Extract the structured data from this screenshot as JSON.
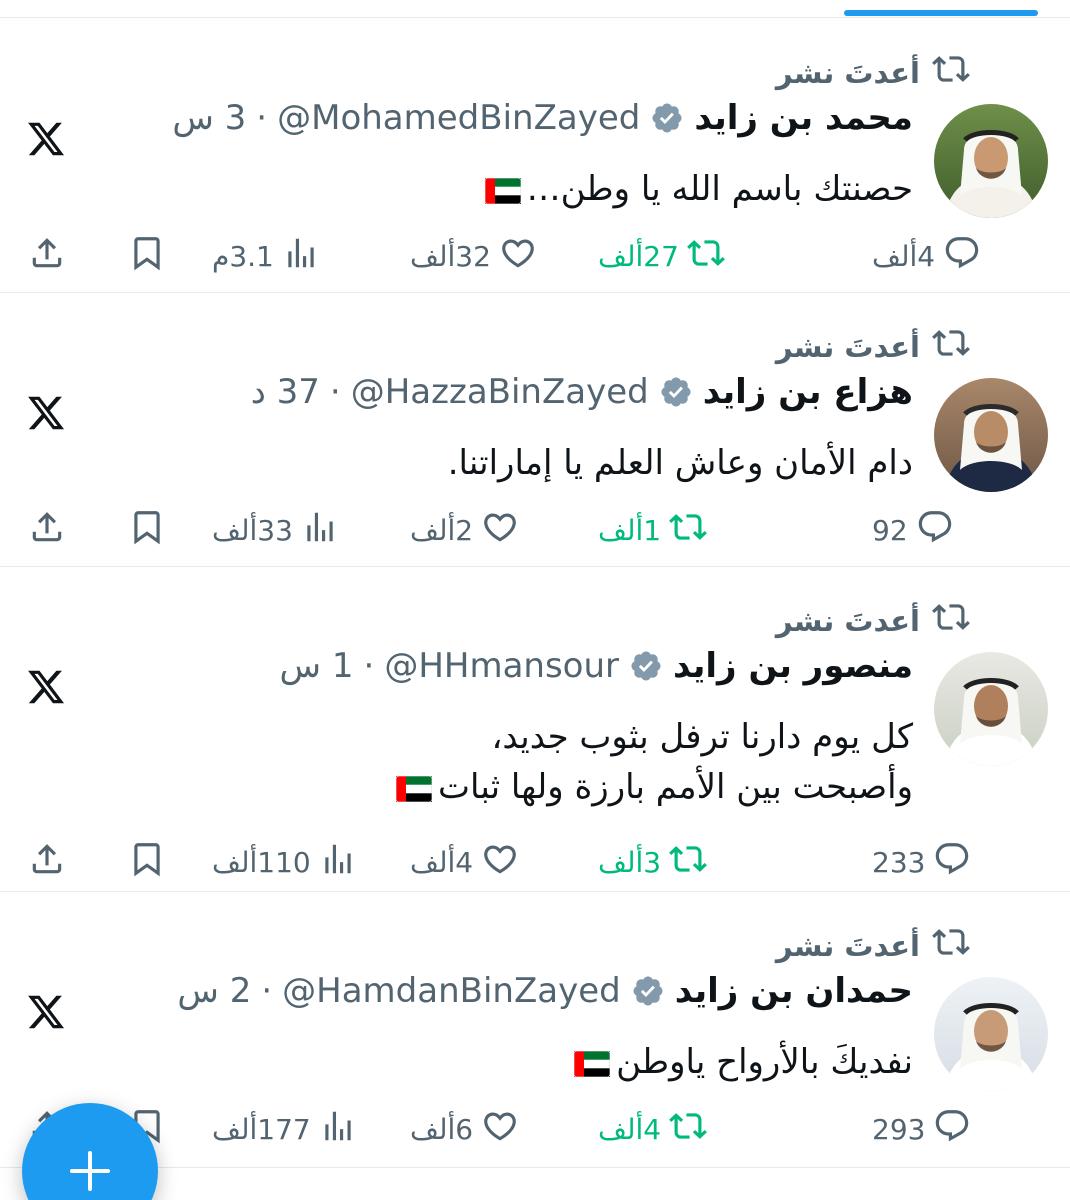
{
  "repost_label": "أعدتَ نشر",
  "tweets": [
    {
      "name": "محمد بن زايد",
      "handle": "@MohamedBinZayed",
      "time": "3 س",
      "text_lines": [
        "حصنتك باسم الله يا وطن…"
      ],
      "has_flag": true,
      "replies": "4ألف",
      "reposts": "27ألف",
      "likes": "32ألف",
      "views": "3.1م"
    },
    {
      "name": "هزاع بن زايد",
      "handle": "@HazzaBinZayed",
      "time": "37 د",
      "text_lines": [
        "دام الأمان وعاش العلم يا إماراتنا."
      ],
      "has_flag": false,
      "replies": "92",
      "reposts": "1ألف",
      "likes": "2ألف",
      "views": "33ألف"
    },
    {
      "name": "منصور بن زايد",
      "handle": "@HHmansour",
      "time": "1 س",
      "text_lines": [
        "كل يوم دارنا ترفل بثوب جديد،",
        "وأصبحت بين الأمم بارزة ولها ثبات"
      ],
      "has_flag": true,
      "replies": "233",
      "reposts": "3ألف",
      "likes": "4ألف",
      "views": "110ألف"
    },
    {
      "name": "حمدان بن زايد",
      "handle": "@HamdanBinZayed",
      "time": "2 س",
      "text_lines": [
        "نفديكَ بالأرواح ياوطن"
      ],
      "has_flag": true,
      "replies": "293",
      "reposts": "4ألف",
      "likes": "6ألف",
      "views": "177ألف"
    }
  ],
  "colors": {
    "accent": "#1d9bf0",
    "text": "#0f1419",
    "muted": "#536471",
    "repost_green": "#00ba7c",
    "divider": "#e7e9ea"
  },
  "icons": {
    "repost": "repost-icon",
    "verified": "verified-badge-icon",
    "x_logo": "x-logo-icon",
    "reply": "reply-icon",
    "like": "heart-icon",
    "views": "views-icon",
    "bookmark": "bookmark-icon",
    "share": "share-icon",
    "compose": "plus-icon"
  }
}
